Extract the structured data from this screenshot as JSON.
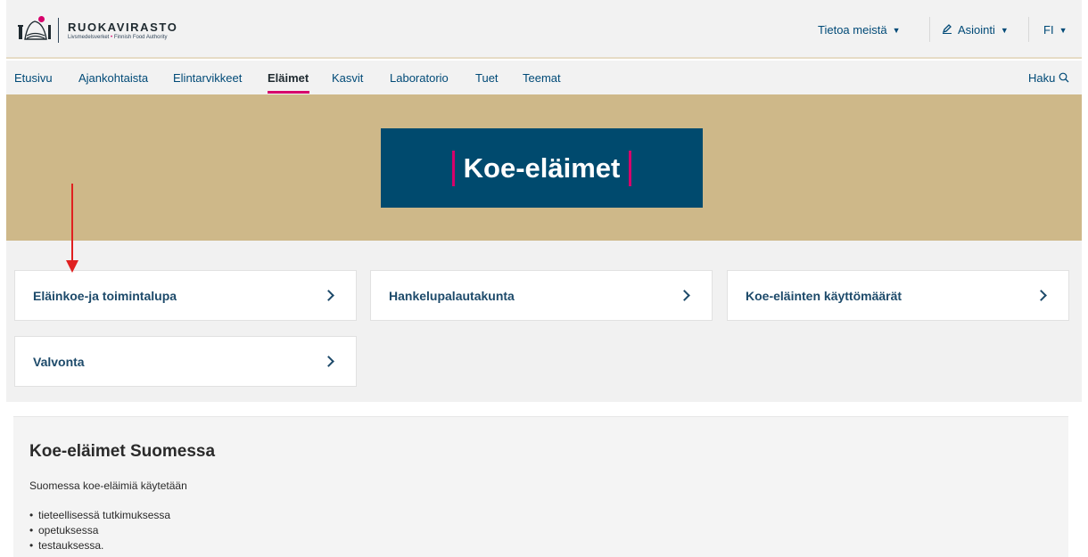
{
  "header": {
    "logo_title": "RUOKAVIRASTO",
    "logo_sub_fi": "Livsmedelsverket",
    "logo_sub_sep": "•",
    "logo_sub_en": "Finnish Food Authority",
    "util": {
      "about_label": "Tietoa meistä",
      "services_label": "Asiointi",
      "lang_label": "FI"
    }
  },
  "nav": {
    "items": [
      "Etusivu",
      "Ajankohtaista",
      "Elintarvikkeet",
      "Eläimet",
      "Kasvit",
      "Laboratorio",
      "Tuet",
      "Teemat"
    ],
    "active": "Eläimet",
    "search_label": "Haku"
  },
  "hero": {
    "title": "Koe-eläimet"
  },
  "cards": [
    {
      "label": "Eläinkoe-ja toimintalupa"
    },
    {
      "label": "Hankelupalautakunta"
    },
    {
      "label": "Koe-eläinten käyttömäärät"
    },
    {
      "label": "Valvonta"
    }
  ],
  "content": {
    "heading": "Koe-eläimet Suomessa",
    "intro": "Suomessa koe-eläimiä käytetään",
    "bullets": [
      "tieteellisessä tutkimuksessa",
      "opetuksessa",
      "testauksessa."
    ]
  },
  "colors": {
    "accent_pink": "#d6006b",
    "hero_bg": "#ceb889",
    "hero_box": "#004a6e",
    "link_blue": "#004a77",
    "annotation_red": "#e02020"
  },
  "icons": {
    "logo": "ruokavirasto-logo-icon",
    "caret": "caret-down-icon",
    "pen": "pen-icon",
    "search": "search-icon",
    "chevron": "chevron-right-icon",
    "annotation": "red-arrow-annotation"
  }
}
